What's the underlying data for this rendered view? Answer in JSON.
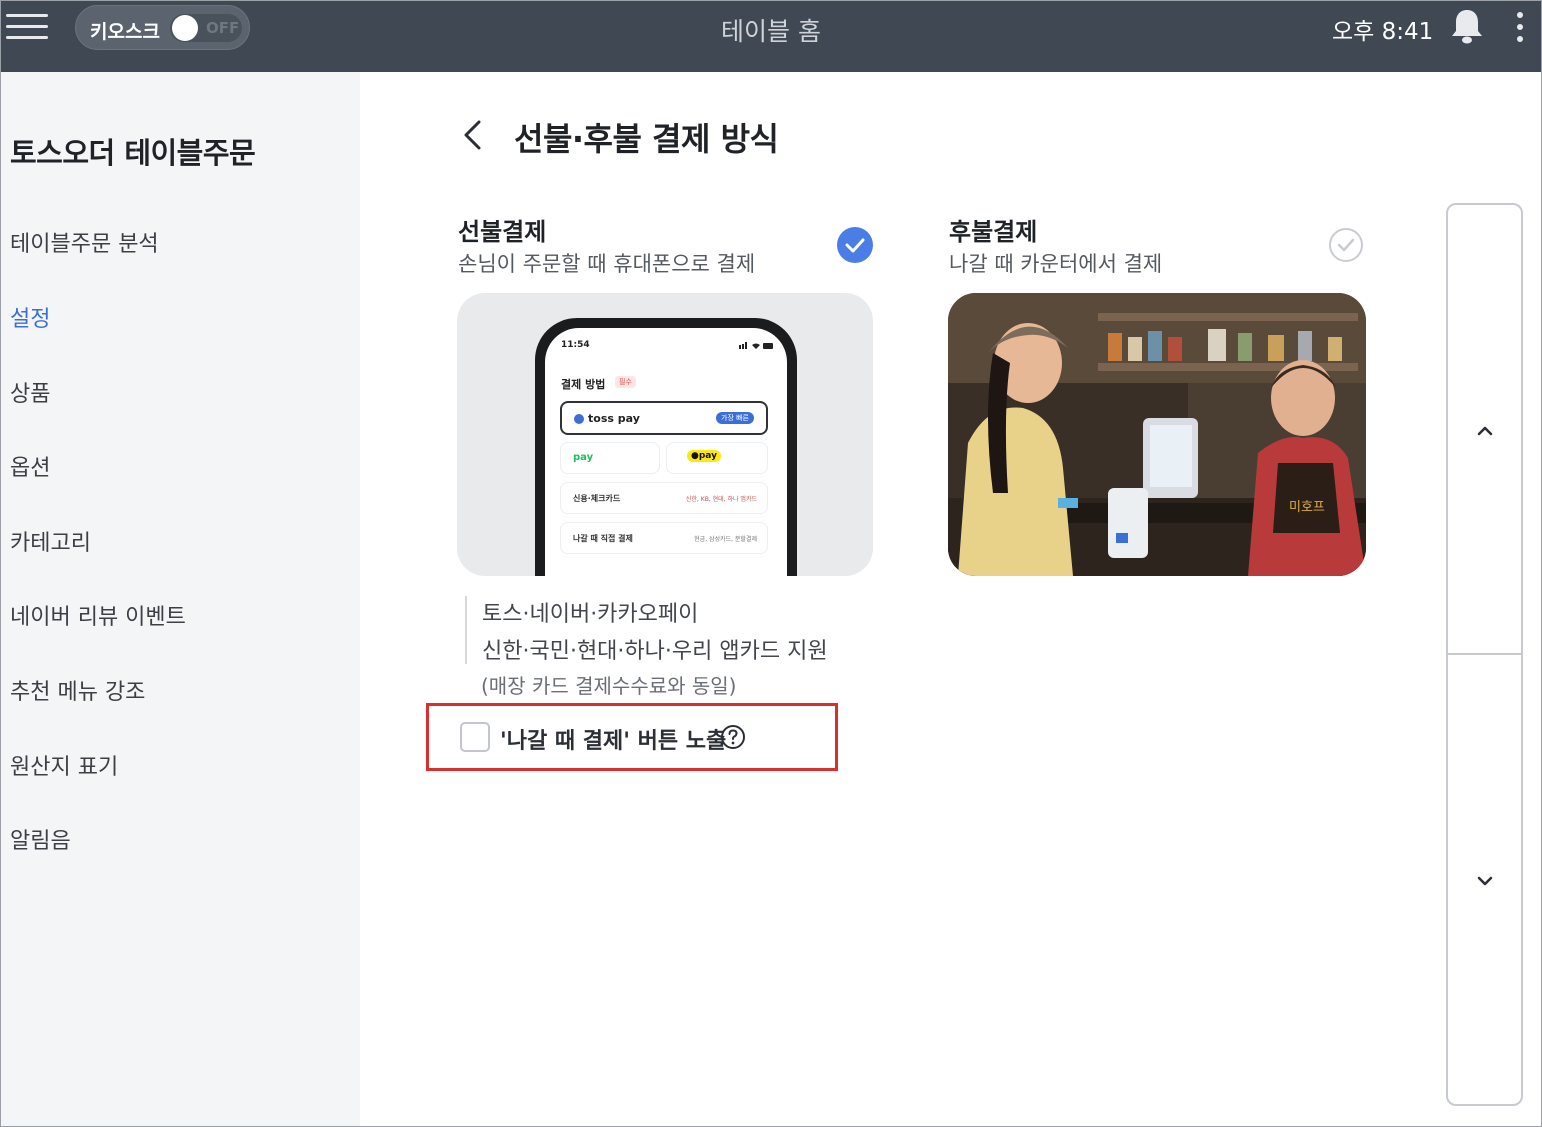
{
  "topbar": {
    "kiosk_label": "키오스크",
    "kiosk_state": "OFF",
    "title": "테이블 홈",
    "time": "오후 8:41"
  },
  "sidebar": {
    "title": "토스오더 테이블주문",
    "items": [
      {
        "label": "테이블주문 분석",
        "active": false
      },
      {
        "label": "설정",
        "active": true
      },
      {
        "label": "상품",
        "active": false
      },
      {
        "label": "옵션",
        "active": false
      },
      {
        "label": "카테고리",
        "active": false
      },
      {
        "label": "네이버 리뷰 이벤트",
        "active": false
      },
      {
        "label": "추천 메뉴 강조",
        "active": false
      },
      {
        "label": "원산지 표기",
        "active": false
      },
      {
        "label": "알림음",
        "active": false
      }
    ]
  },
  "main": {
    "title": "선불·후불 결제 방식",
    "prepay": {
      "title": "선불결제",
      "subtitle": "손님이 주문할 때 휴대폰으로 결제",
      "selected": true,
      "phone": {
        "time": "11:54",
        "heading": "결제 방법",
        "badge": "필수",
        "toss_label": "toss pay",
        "toss_tag": "가장 빠른",
        "npay_label": "pay",
        "kpay_label": "●pay",
        "card_label": "신용·체크카드",
        "card_note": "신한, KB, 현대, 하나 앱카드",
        "later_label": "나갈 때 직접 결제",
        "later_note": "현금, 삼성카드, 분할결제"
      },
      "desc_lines": [
        "토스·네이버·카카오페이",
        "신한·국민·현대·하나·우리 앱카드 지원"
      ],
      "note": "(매장 카드 결제수수료와 동일)"
    },
    "postpay": {
      "title": "후불결제",
      "subtitle": "나갈 때 카운터에서 결제",
      "selected": false,
      "apron_text": "미호프"
    },
    "checkbox": {
      "label": "'나갈 때 결제' 버튼 노출",
      "checked": false
    }
  },
  "colors": {
    "topbar": "#3f4853",
    "accent": "#4a7de6",
    "active_nav": "#3b6fd8",
    "highlight": "#d9302b",
    "sidebar_bg": "#f4f5f7"
  },
  "icons": [
    "hamburger-menu-icon",
    "bell-icon",
    "kebab-menu-icon",
    "back-chevron-icon",
    "check-icon",
    "help-icon",
    "chevron-up-icon",
    "chevron-down-icon"
  ]
}
